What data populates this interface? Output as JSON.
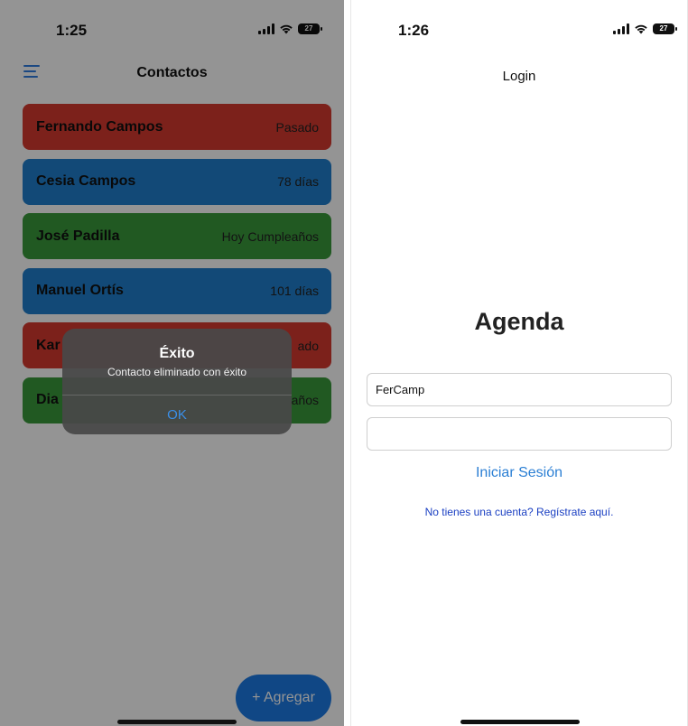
{
  "colors": {
    "card_red": "#d63a2f",
    "card_blue": "#1f7fce",
    "card_green": "#3a9a3c",
    "accent_blue": "#1c7be6",
    "link_blue": "#1a3fc2"
  },
  "left_screen": {
    "status_bar": {
      "time": "1:25",
      "battery": "27",
      "icons": [
        "signal-icon",
        "wifi-icon",
        "battery-icon"
      ]
    },
    "nav": {
      "title": "Contactos",
      "menu_icon": "menu-icon"
    },
    "contacts": [
      {
        "name": "Fernando Campos",
        "status": "Pasado",
        "color": "#d63a2f"
      },
      {
        "name": "Cesia Campos",
        "status": "78 días",
        "color": "#1f7fce"
      },
      {
        "name": "José Padilla",
        "status": "Hoy Cumpleaños",
        "color": "#3a9a3c"
      },
      {
        "name": "Manuel Ortís",
        "status": "101 días",
        "color": "#1f7fce"
      },
      {
        "name": "Kar",
        "status": "ado",
        "color": "#d63a2f"
      },
      {
        "name": "Dia",
        "status": "años",
        "color": "#3a9a3c"
      }
    ],
    "alert": {
      "title": "Éxito",
      "message": "Contacto eliminado con éxito",
      "ok_label": "OK"
    },
    "fab_label": "+ Agregar"
  },
  "right_screen": {
    "status_bar": {
      "time": "1:26",
      "battery": "27",
      "icons": [
        "signal-icon",
        "wifi-icon",
        "battery-icon"
      ]
    },
    "nav": {
      "title": "Login"
    },
    "app_title": "Agenda",
    "username_value": "FerCamp",
    "password_value": "",
    "login_button": "Iniciar Sesión",
    "register_link": "No tienes una cuenta? Regístrate aquí."
  }
}
